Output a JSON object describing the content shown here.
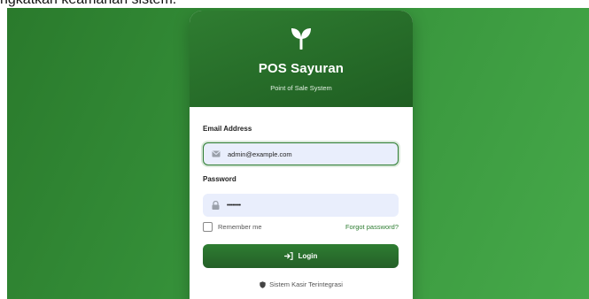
{
  "caption_fragment": "ngkatkan keamanan sistem.",
  "brand": {
    "title": "POS Sayuran",
    "subtitle": "Point of Sale System",
    "logo_icon": "sprout-icon"
  },
  "form": {
    "email_label": "Email Address",
    "email_value": "admin@example.com",
    "email_icon": "envelope-icon",
    "password_label": "Password",
    "password_value": "••••••••",
    "password_icon": "lock-icon",
    "remember_label": "Remember me",
    "remember_checked": false,
    "forgot_label": "Forgot password?",
    "login_label": "Login",
    "login_icon": "sign-in-icon"
  },
  "footer": {
    "text": "Sistem Kasir Terintegrasi",
    "icon": "shield-icon"
  },
  "colors": {
    "primary": "#2e7d32",
    "header_dark": "#1f5e22",
    "field_bg": "#e9eefc"
  }
}
